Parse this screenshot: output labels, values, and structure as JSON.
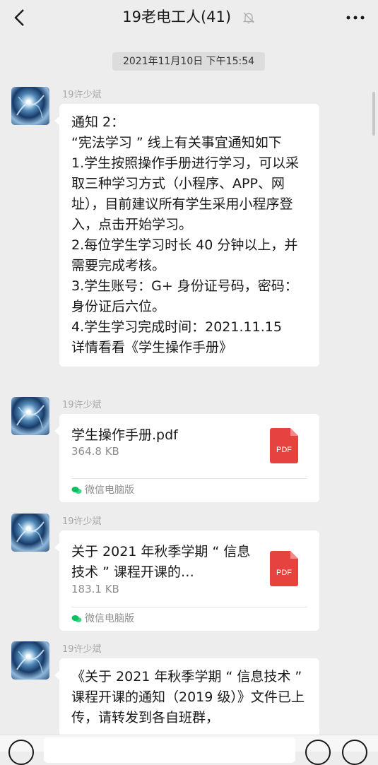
{
  "header": {
    "title": "19老电工人(41)",
    "icons": {
      "back": "chevron-left-icon",
      "mute": "bell-muted-icon",
      "more": "more-icon"
    }
  },
  "chat": {
    "timestamp": "2021年11月10日 下午15:54",
    "messages": [
      {
        "sender": "19许少斌",
        "type": "text",
        "text": "通知 2：\n“宪法学习 ” 线上有关事宜通知如下\n1.学生按照操作手册进行学习，可以采取三种学习方式（小程序、APP、网址），目前建议所有学生采用小程序登入，点击开始学习。\n2.每位学生学习时长 40 分钟以上，并需要完成考核。\n3.学生账号：G+ 身份证号码，密码：身份证后六位。\n4.学生学习完成时间：2021.11.15\n详情看看《学生操作手册》"
      },
      {
        "sender": "19许少斌",
        "type": "file",
        "file_name": "学生操作手册.pdf",
        "file_size": "364.8 KB",
        "file_icon_label": "PDF",
        "source": "微信电脑版"
      },
      {
        "sender": "19许少斌",
        "type": "file",
        "file_name": "关于 2021 年秋季学期 “ 信息技术 ” 课程开课的…",
        "file_size": "183.1 KB",
        "file_icon_label": "PDF",
        "source": "微信电脑版"
      },
      {
        "sender": "19许少斌",
        "type": "text",
        "text": "《关于 2021 年秋季学期 “ 信息技术 ” 课程开课的通知（2019 级）》文件已上传，请转发到各自班群，"
      }
    ]
  },
  "colors": {
    "background": "#ededed",
    "bubble": "#ffffff",
    "pdf_red": "#e64340",
    "wechat_green": "#07c160"
  },
  "input_bar": {
    "icons": [
      "voice-icon",
      "emoji-icon",
      "plus-icon"
    ]
  }
}
